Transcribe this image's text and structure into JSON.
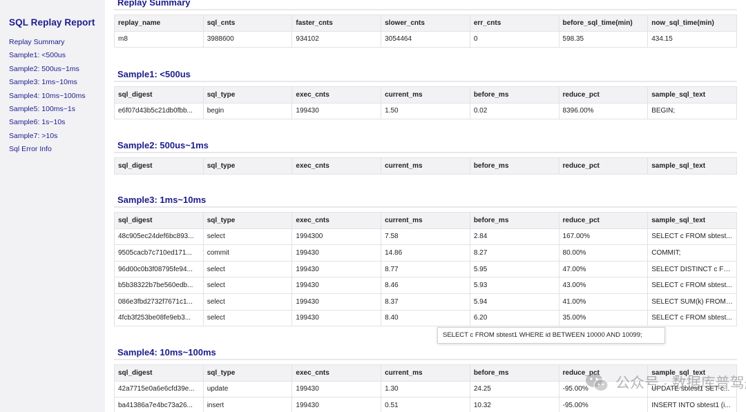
{
  "sidebar": {
    "title": "SQL Replay Report",
    "items": [
      "Replay Summary",
      "Sample1: <500us",
      "Sample2: 500us~1ms",
      "Sample3: 1ms~10ms",
      "Sample4: 10ms~100ms",
      "Sample5: 100ms~1s",
      "Sample6: 1s~10s",
      "Sample7: >10s",
      "Sql Error Info"
    ]
  },
  "summary": {
    "title": "Replay Summary",
    "headers": [
      "replay_name",
      "sql_cnts",
      "faster_cnts",
      "slower_cnts",
      "err_cnts",
      "before_sql_time(min)",
      "now_sql_time(min)"
    ],
    "rows": [
      [
        "m8",
        "3988600",
        "934102",
        "3054464",
        "0",
        "598.35",
        "434.15"
      ]
    ]
  },
  "sample_headers": [
    "sql_digest",
    "sql_type",
    "exec_cnts",
    "current_ms",
    "before_ms",
    "reduce_pct",
    "sample_sql_text"
  ],
  "sample1": {
    "title": "Sample1: <500us",
    "rows": [
      [
        "e6f07d43b5c21db0fbb...",
        "begin",
        "199430",
        "1.50",
        "0.02",
        "8396.00%",
        "BEGIN;"
      ]
    ]
  },
  "sample2": {
    "title": "Sample2: 500us~1ms",
    "rows": []
  },
  "sample3": {
    "title": "Sample3: 1ms~10ms",
    "rows": [
      [
        "48c905ec24def6bc893...",
        "select",
        "1994300",
        "7.58",
        "2.84",
        "167.00%",
        "SELECT c FROM sbtest..."
      ],
      [
        "9505cacb7c710ed171...",
        "commit",
        "199430",
        "14.86",
        "8.27",
        "80.00%",
        "COMMIT;"
      ],
      [
        "96d00c0b3f08795fe94...",
        "select",
        "199430",
        "8.77",
        "5.95",
        "47.00%",
        "SELECT DISTINCT c FR..."
      ],
      [
        "b5b38322b7be560edb...",
        "select",
        "199430",
        "8.46",
        "5.93",
        "43.00%",
        "SELECT c FROM sbtest..."
      ],
      [
        "086e3fbd2732f7671c1...",
        "select",
        "199430",
        "8.37",
        "5.94",
        "41.00%",
        "SELECT SUM(k) FROM ..."
      ],
      [
        "4fcb3f253be08fe9eb3...",
        "select",
        "199430",
        "8.40",
        "6.20",
        "35.00%",
        "SELECT c FROM sbtest..."
      ]
    ]
  },
  "sample4": {
    "title": "Sample4: 10ms~100ms",
    "rows": [
      [
        "42a7715e0a6e6cfd39e...",
        "update",
        "199430",
        "1.30",
        "24.25",
        "-95.00%",
        "UPDATE sbtest1 SET c..."
      ],
      [
        "ba41386a7e4bc73a26...",
        "insert",
        "199430",
        "0.51",
        "10.32",
        "-95.00%",
        "INSERT INTO sbtest1 (i..."
      ]
    ]
  },
  "tooltip": {
    "text": "SELECT c FROM sbtest1 WHERE id BETWEEN 10000 AND 10099;"
  },
  "watermark": {
    "icon": "wechat-icon",
    "text": "公众号 · 数据库普驾舱"
  }
}
